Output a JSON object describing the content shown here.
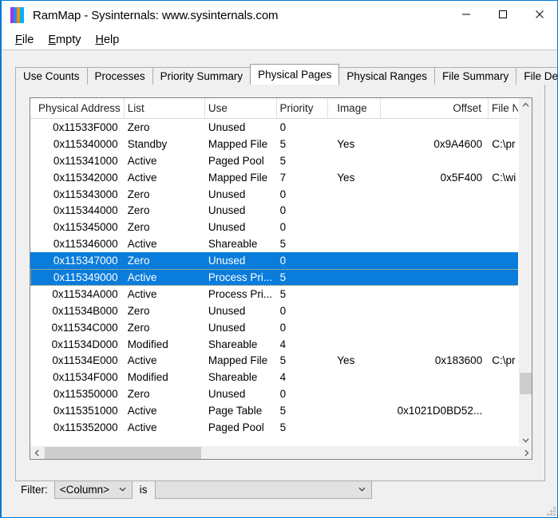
{
  "window": {
    "title": "RamMap - Sysinternals: www.sysinternals.com",
    "icon": "rammap-icon",
    "buttons": {
      "minimize": "minimize-icon",
      "maximize": "maximize-icon",
      "close": "close-icon"
    },
    "accent_color": "#0078d7"
  },
  "menubar": {
    "items": [
      {
        "accel": "F",
        "rest": "ile"
      },
      {
        "accel": "E",
        "rest": "mpty"
      },
      {
        "accel": "H",
        "rest": "elp"
      }
    ]
  },
  "tabs": [
    {
      "label": "Use Counts",
      "active": false
    },
    {
      "label": "Processes",
      "active": false
    },
    {
      "label": "Priority Summary",
      "active": false
    },
    {
      "label": "Physical Pages",
      "active": true
    },
    {
      "label": "Physical Ranges",
      "active": false
    },
    {
      "label": "File Summary",
      "active": false
    },
    {
      "label": "File Details",
      "active": false
    }
  ],
  "table": {
    "columns": [
      {
        "label": "Physical Address",
        "align": "right"
      },
      {
        "label": "List",
        "align": "left"
      },
      {
        "label": "Use",
        "align": "left"
      },
      {
        "label": "Priority",
        "align": "left"
      },
      {
        "label": "Image",
        "align": "left"
      },
      {
        "label": "Offset",
        "align": "right"
      },
      {
        "label": "File N",
        "align": "left"
      }
    ],
    "sort_indicator": "chevron-up-icon",
    "rows": [
      {
        "address": "0x11533F000",
        "list": "Zero",
        "use": "Unused",
        "priority": "0",
        "image": "",
        "offset": "",
        "file": "",
        "selected": false,
        "focused": false
      },
      {
        "address": "0x115340000",
        "list": "Standby",
        "use": "Mapped File",
        "priority": "5",
        "image": "Yes",
        "offset": "0x9A4600",
        "file": "C:\\pr",
        "selected": false,
        "focused": false
      },
      {
        "address": "0x115341000",
        "list": "Active",
        "use": "Paged Pool",
        "priority": "5",
        "image": "",
        "offset": "",
        "file": "",
        "selected": false,
        "focused": false
      },
      {
        "address": "0x115342000",
        "list": "Active",
        "use": "Mapped File",
        "priority": "7",
        "image": "Yes",
        "offset": "0x5F400",
        "file": "C:\\wi",
        "selected": false,
        "focused": false
      },
      {
        "address": "0x115343000",
        "list": "Zero",
        "use": "Unused",
        "priority": "0",
        "image": "",
        "offset": "",
        "file": "",
        "selected": false,
        "focused": false
      },
      {
        "address": "0x115344000",
        "list": "Zero",
        "use": "Unused",
        "priority": "0",
        "image": "",
        "offset": "",
        "file": "",
        "selected": false,
        "focused": false
      },
      {
        "address": "0x115345000",
        "list": "Zero",
        "use": "Unused",
        "priority": "0",
        "image": "",
        "offset": "",
        "file": "",
        "selected": false,
        "focused": false
      },
      {
        "address": "0x115346000",
        "list": "Active",
        "use": "Shareable",
        "priority": "5",
        "image": "",
        "offset": "",
        "file": "",
        "selected": false,
        "focused": false
      },
      {
        "address": "0x115347000",
        "list": "Zero",
        "use": "Unused",
        "priority": "0",
        "image": "",
        "offset": "",
        "file": "",
        "selected": true,
        "focused": false
      },
      {
        "address": "0x115349000",
        "list": "Active",
        "use": "Process Pri...",
        "priority": "5",
        "image": "",
        "offset": "",
        "file": "",
        "selected": true,
        "focused": true
      },
      {
        "address": "0x11534A000",
        "list": "Active",
        "use": "Process Pri...",
        "priority": "5",
        "image": "",
        "offset": "",
        "file": "",
        "selected": false,
        "focused": false
      },
      {
        "address": "0x11534B000",
        "list": "Zero",
        "use": "Unused",
        "priority": "0",
        "image": "",
        "offset": "",
        "file": "",
        "selected": false,
        "focused": false
      },
      {
        "address": "0x11534C000",
        "list": "Zero",
        "use": "Unused",
        "priority": "0",
        "image": "",
        "offset": "",
        "file": "",
        "selected": false,
        "focused": false
      },
      {
        "address": "0x11534D000",
        "list": "Modified",
        "use": "Shareable",
        "priority": "4",
        "image": "",
        "offset": "",
        "file": "",
        "selected": false,
        "focused": false
      },
      {
        "address": "0x11534E000",
        "list": "Active",
        "use": "Mapped File",
        "priority": "5",
        "image": "Yes",
        "offset": "0x183600",
        "file": "C:\\pr",
        "selected": false,
        "focused": false
      },
      {
        "address": "0x11534F000",
        "list": "Modified",
        "use": "Shareable",
        "priority": "4",
        "image": "",
        "offset": "",
        "file": "",
        "selected": false,
        "focused": false
      },
      {
        "address": "0x115350000",
        "list": "Zero",
        "use": "Unused",
        "priority": "0",
        "image": "",
        "offset": "",
        "file": "",
        "selected": false,
        "focused": false
      },
      {
        "address": "0x115351000",
        "list": "Active",
        "use": "Page Table",
        "priority": "5",
        "image": "",
        "offset": "0x1021D0BD52...",
        "file": "",
        "selected": false,
        "focused": false
      },
      {
        "address": "0x115352000",
        "list": "Active",
        "use": "Paged Pool",
        "priority": "5",
        "image": "",
        "offset": "",
        "file": "",
        "selected": false,
        "focused": false
      }
    ]
  },
  "scrollbars": {
    "vertical": {
      "up": "chevron-up-icon",
      "down": "chevron-down-icon"
    },
    "horizontal": {
      "left": "chevron-left-icon",
      "right": "chevron-right-icon"
    }
  },
  "filter": {
    "label": "Filter:",
    "column_value": "<Column>",
    "is_label": "is",
    "value_value": "",
    "dropdown_icon": "chevron-down-icon"
  },
  "grip": "resize-grip-icon",
  "colors": {
    "selection_blue": "#0a7cdb",
    "window_border": "#0078d7",
    "face": "#f0f0f0",
    "scroll_thumb": "#cdcdcd"
  }
}
